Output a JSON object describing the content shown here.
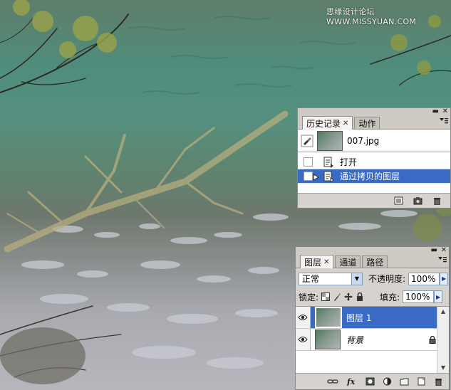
{
  "watermark": "思缘设计论坛 WWW.MISSYUAN.COM",
  "history_panel": {
    "tabs": [
      {
        "label": "历史记录",
        "active": true,
        "closable": true
      },
      {
        "label": "动作",
        "active": false,
        "closable": false
      }
    ],
    "snapshot": {
      "label": "007.jpg"
    },
    "states": [
      {
        "label": "打开",
        "selected": false
      },
      {
        "label": "通过拷贝的图层",
        "selected": true
      }
    ],
    "footer_icons": [
      "new-document-icon",
      "camera-icon",
      "trash-icon"
    ]
  },
  "layers_panel": {
    "tabs": [
      {
        "label": "图层",
        "active": true,
        "closable": true
      },
      {
        "label": "通道",
        "active": false,
        "closable": false
      },
      {
        "label": "路径",
        "active": false,
        "closable": false
      }
    ],
    "blend_mode": "正常",
    "opacity_label": "不透明度:",
    "opacity_value": "100%",
    "lock_label": "锁定:",
    "fill_label": "填充:",
    "fill_value": "100%",
    "layers": [
      {
        "name": "图层 1",
        "selected": true,
        "visible": true,
        "locked": false
      },
      {
        "name": "背景",
        "selected": false,
        "visible": true,
        "locked": true
      }
    ],
    "footer_icons": [
      "link-icon",
      "fx-icon",
      "mask-icon",
      "adjustment-icon",
      "folder-icon",
      "new-layer-icon",
      "trash-icon"
    ]
  },
  "colors": {
    "selection": "#3a6bc4",
    "panel_bg": "#d6d3ce"
  }
}
